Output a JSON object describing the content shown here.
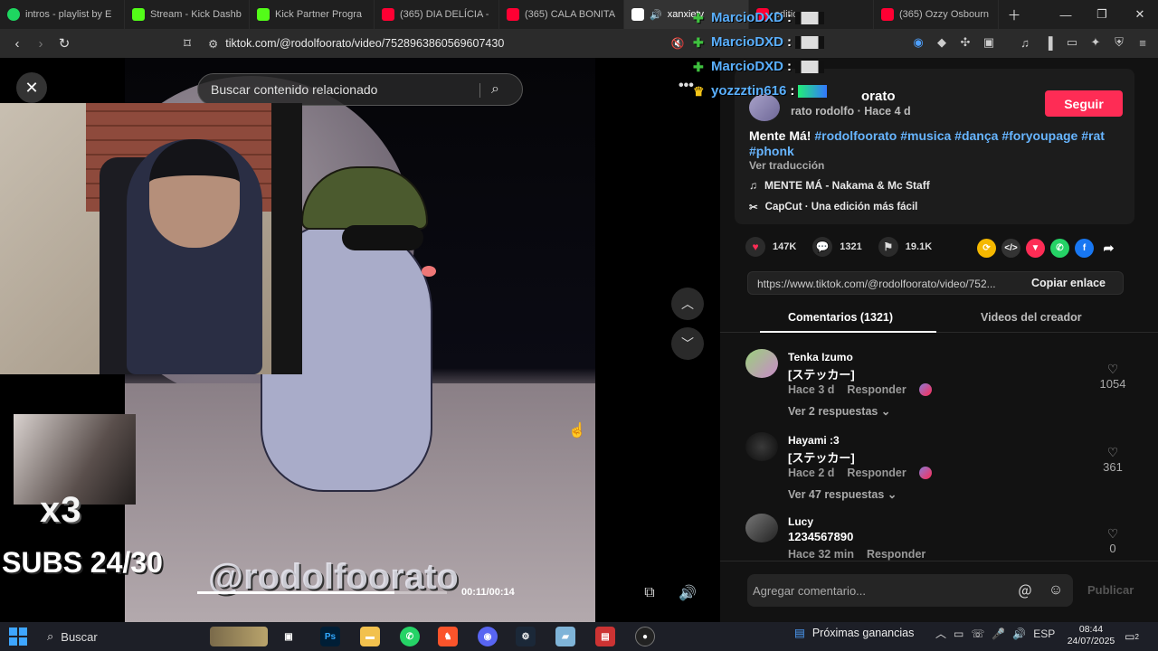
{
  "browser": {
    "tabs": [
      {
        "label": "intros - playlist by E",
        "icon": "spotify-icon",
        "color": "#1ed760"
      },
      {
        "label": "Stream - Kick Dashb",
        "icon": "kick-icon",
        "color": "#53fc18"
      },
      {
        "label": "Kick Partner Progra",
        "icon": "kick-icon",
        "color": "#53fc18"
      },
      {
        "label": "(365) DIA DELÍCIA -",
        "icon": "youtube-icon",
        "color": "#ff0033"
      },
      {
        "label": "(365) CALA BONITA",
        "icon": "youtube-icon",
        "color": "#ff0033"
      },
      {
        "label": "xanxiety",
        "icon": "tiktok-icon",
        "color": "#ffffff"
      },
      {
        "label": "edition",
        "icon": "youtube-icon",
        "color": "#ff0033"
      },
      {
        "label": "(365) Ozzy Osbourn",
        "icon": "youtube-icon",
        "color": "#ff0033"
      }
    ],
    "url": "tiktok.com/@rodolfoorato/video/7528963860569607430"
  },
  "chat": [
    {
      "user": "MarcioDXD",
      "sep": ":"
    },
    {
      "user": "MarcioDXD",
      "sep": ":"
    },
    {
      "user": "MarcioDXD",
      "sep": ":"
    },
    {
      "user": "yozzztin616",
      "sep": ":"
    }
  ],
  "video": {
    "search_placeholder": "Buscar contenido relacionado",
    "overlay_multiplier": "x3",
    "overlay_subs": "SUBS 24/30",
    "watermark": "@rodolfoorato",
    "time": "00:11/00:14",
    "progress": 0.79
  },
  "author": {
    "name": "rodolfoorato",
    "name_visible": "orato",
    "sub": "rato rodolfo · Hace 4 d",
    "follow_label": "Seguir",
    "desc_text": "Mente Má! ",
    "hashtags": [
      "#rodolfoorato",
      "#musica",
      "#dança",
      "#foryoupage",
      "#rat",
      "#phonk"
    ],
    "translate": "Ver traducción",
    "music": "MENTE MÁ - Nakama & Mc Staff",
    "capcut": "CapCut · Una edición más fácil"
  },
  "stats": {
    "likes": "147K",
    "comments": "1321",
    "saves": "19.1K"
  },
  "share": {
    "link": "https://www.tiktok.com/@rodolfoorato/video/752...",
    "copy_label": "Copiar enlace"
  },
  "panel_tabs": {
    "comments": "Comentarios (1321)",
    "creator": "Videos del creador"
  },
  "comments": [
    {
      "name": "Tenka Izumo",
      "text": "[ステッカー]",
      "time": "Hace 3 d",
      "reply": "Responder",
      "replies": "Ver 2 respuestas",
      "likes": "1054"
    },
    {
      "name": "Hayami :3",
      "text": "[ステッカー]",
      "time": "Hace 2 d",
      "reply": "Responder",
      "replies": "Ver 47 respuestas",
      "likes": "361"
    },
    {
      "name": "Lucy",
      "text": "1234567890",
      "time": "Hace 32 min",
      "reply": "Responder",
      "replies": "",
      "likes": "0"
    }
  ],
  "comment_box": {
    "placeholder": "Agregar comentario...",
    "publish": "Publicar"
  },
  "taskbar": {
    "search": "Buscar",
    "widget": "Próximas ganancias",
    "lang": "ESP",
    "time": "08:44",
    "date": "24/07/2025",
    "notifications": "2"
  }
}
